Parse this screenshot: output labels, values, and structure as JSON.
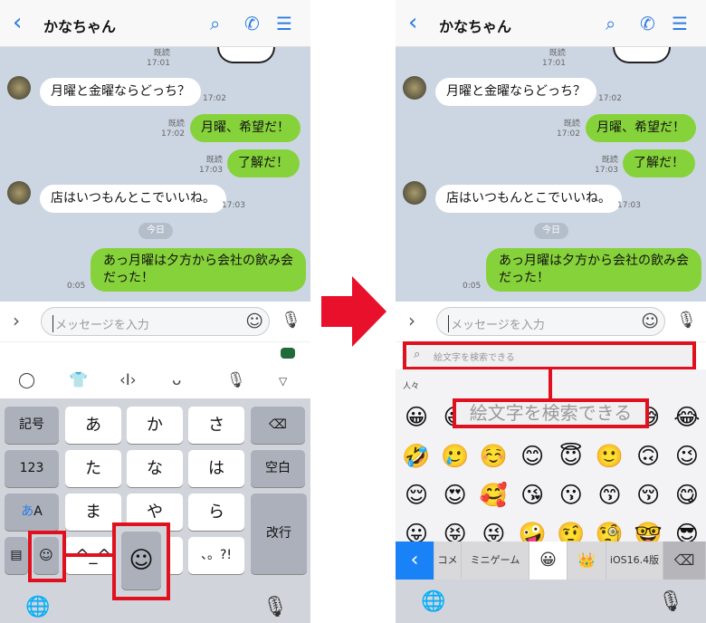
{
  "header": {
    "title": "かなちゃん",
    "back_icon": "chevron-left-icon",
    "search_icon": "search-icon",
    "call_icon": "phone-icon",
    "menu_icon": "menu-icon"
  },
  "messages": [
    {
      "side": "out",
      "read": "既読",
      "time": "17:01"
    },
    {
      "side": "in",
      "text": "月曜と金曜ならどっち？",
      "time": "17:02"
    },
    {
      "side": "out",
      "text": "月曜、希望だ！",
      "read": "既読",
      "time": "17:02"
    },
    {
      "side": "out",
      "text": "了解だ！",
      "read": "既読",
      "time": "17:03"
    },
    {
      "side": "in",
      "text": "店はいつもんとこでいいね。",
      "time": "17:03"
    },
    {
      "side": "out",
      "text": "あっ月曜は夕方から会社の飲み会\nだった！",
      "time": "0:05"
    }
  ],
  "date_divider": "今日",
  "input": {
    "placeholder": "メッセージを入力"
  },
  "keyboard": {
    "rows": [
      [
        "記号",
        "あ",
        "か",
        "さ",
        "⌫"
      ],
      [
        "123",
        "た",
        "な",
        "は",
        "空白"
      ],
      [
        "あA",
        "ま",
        "や",
        "ら",
        "改行"
      ],
      [
        "",
        "",
        "^_^",
        "",
        "、。?!"
      ]
    ],
    "kana_switch": {
      "blue": "あ",
      "rest": "A"
    },
    "enter": "改行",
    "space": "空白"
  },
  "emoji_picker": {
    "search_placeholder": "絵文字を検索できる",
    "category": "人々",
    "callout": "絵文字を検索できる",
    "rows": [
      [
        "😀",
        "😃",
        "😄",
        "😁",
        "😆",
        "🥹",
        "😅",
        "😂"
      ],
      [
        "🤣",
        "🥲",
        "☺️",
        "😊",
        "😇",
        "🙂",
        "🙃",
        "😉"
      ],
      [
        "😌",
        "😍",
        "🥰",
        "😘",
        "😗",
        "😙",
        "😚",
        "😋"
      ],
      [
        "😛",
        "😝",
        "😜",
        "🤪",
        "🤨",
        "🧐",
        "🤓",
        "😎"
      ]
    ],
    "tabs": [
      "コメ",
      "ミニゲーム",
      "😀",
      "👑",
      "iOS16.4版"
    ]
  },
  "colors": {
    "accent": "#2a7be4",
    "bubble_out": "#86d23a",
    "highlight": "#e0101e",
    "arrow": "#e8102a"
  }
}
